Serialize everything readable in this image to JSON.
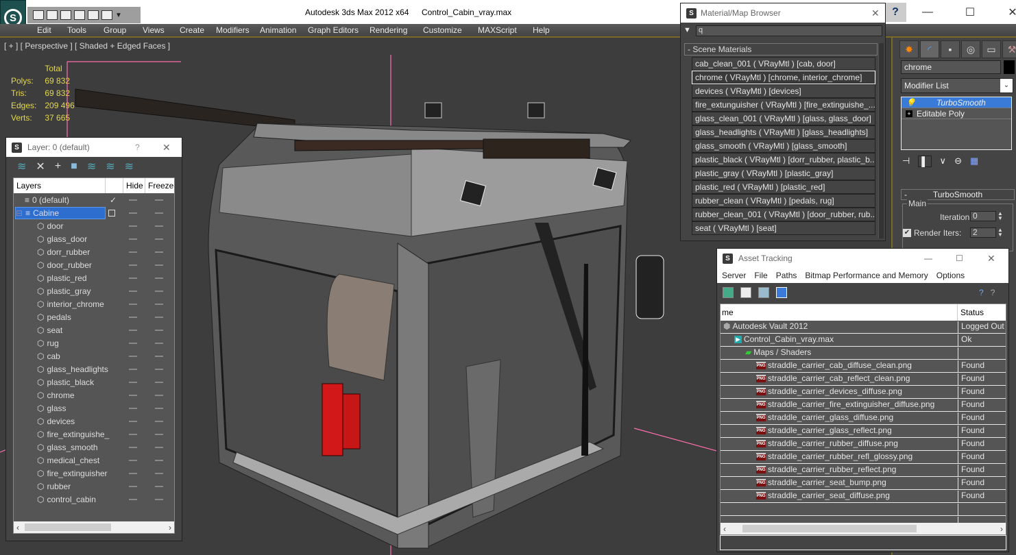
{
  "app": {
    "title": "Autodesk 3ds Max  2012 x64",
    "file": "Control_Cabin_vray.max"
  },
  "menu": [
    "Edit",
    "Tools",
    "Group",
    "Views",
    "Create",
    "Modifiers",
    "Animation",
    "Graph Editors",
    "Rendering",
    "Customize",
    "MAXScript",
    "Help"
  ],
  "viewport": {
    "label": "[ + ] [ Perspective ] [ Shaded + Edged Faces ]",
    "stats": {
      "header": "Total",
      "rows": [
        {
          "label": "Polys:",
          "value": "69 832"
        },
        {
          "label": "Tris:",
          "value": "69 832"
        },
        {
          "label": "Edges:",
          "value": "209 496"
        },
        {
          "label": "Verts:",
          "value": "37 665"
        }
      ]
    }
  },
  "layer_dialog": {
    "title": "Layer: 0 (default)",
    "help": "?",
    "close": "✕",
    "columns": [
      "Layers",
      "",
      "Hide",
      "Freeze"
    ],
    "layers": [
      {
        "name": "0 (default)",
        "type": "layer",
        "current": true
      },
      {
        "name": "Cabine",
        "type": "layer",
        "selected": true
      },
      {
        "name": "door",
        "type": "object"
      },
      {
        "name": "glass_door",
        "type": "object"
      },
      {
        "name": "dorr_rubber",
        "type": "object"
      },
      {
        "name": "door_rubber",
        "type": "object"
      },
      {
        "name": "plastic_red",
        "type": "object"
      },
      {
        "name": "plastic_gray",
        "type": "object"
      },
      {
        "name": "interior_chrome",
        "type": "object"
      },
      {
        "name": "pedals",
        "type": "object"
      },
      {
        "name": "seat",
        "type": "object"
      },
      {
        "name": "rug",
        "type": "object"
      },
      {
        "name": "cab",
        "type": "object"
      },
      {
        "name": "glass_headlights",
        "type": "object"
      },
      {
        "name": "plastic_black",
        "type": "object"
      },
      {
        "name": "chrome",
        "type": "object"
      },
      {
        "name": "glass",
        "type": "object"
      },
      {
        "name": "devices",
        "type": "object"
      },
      {
        "name": "fire_extinguishe_",
        "type": "object"
      },
      {
        "name": "glass_smooth",
        "type": "object"
      },
      {
        "name": "medical_chest",
        "type": "object"
      },
      {
        "name": "fire_extinguisher",
        "type": "object"
      },
      {
        "name": "rubber",
        "type": "object"
      },
      {
        "name": "control_cabin",
        "type": "object"
      }
    ]
  },
  "material_browser": {
    "title": "Material/Map Browser",
    "search_value": "q",
    "section": "- Scene Materials",
    "materials": [
      "cab_clean_001  ( VRayMtl ) [cab, door]",
      "chrome  ( VRayMtl ) [chrome, interior_chrome]",
      "devices  ( VRayMtl ) [devices]",
      "fire_extunguisher  ( VRayMtl ) [fire_extinguishe_...",
      "glass_clean_001  ( VRayMtl ) [glass, glass_door]",
      "glass_headlights  ( VRayMtl ) [glass_headlights]",
      "glass_smooth  ( VRayMtl ) [glass_smooth]",
      "plastic_black  ( VRayMtl ) [dorr_rubber, plastic_b...",
      "plastic_gray  ( VRayMtl ) [plastic_gray]",
      "plastic_red  ( VRayMtl ) [plastic_red]",
      "rubber_clean  ( VRayMtl ) [pedals, rug]",
      "rubber_clean_001  ( VRayMtl ) [door_rubber, rub...",
      "seat  ( VRayMtl ) [seat]"
    ],
    "selected_index": 1
  },
  "command_panel": {
    "object_name": "chrome",
    "modifier_list": "Modifier List",
    "stack": [
      "TurboSmooth",
      "Editable Poly"
    ],
    "rollout": "TurboSmooth",
    "group": "Main",
    "iterations_label": "Iterations:",
    "iterations": "0",
    "render_iters_label": "Render Iters:",
    "render_iters": "2",
    "render_iters_checked": true
  },
  "asset_tracking": {
    "title": "Asset Tracking",
    "menu": [
      "Server",
      "File",
      "Paths",
      "Bitmap Performance and Memory",
      "Options"
    ],
    "columns": [
      "me",
      "Status"
    ],
    "rows": [
      {
        "name": "Autodesk Vault 2012",
        "status": "Logged Out .",
        "level": 0,
        "icon": "vault"
      },
      {
        "name": "Control_Cabin_vray.max",
        "status": "Ok",
        "level": 1,
        "icon": "max"
      },
      {
        "name": "Maps / Shaders",
        "status": "",
        "level": 2,
        "icon": "maps"
      },
      {
        "name": "straddle_carrier_cab_diffuse_clean.png",
        "status": "Found",
        "level": 3,
        "icon": "png"
      },
      {
        "name": "straddle_carrier_cab_reflect_clean.png",
        "status": "Found",
        "level": 3,
        "icon": "png"
      },
      {
        "name": "straddle_carrier_devices_diffuse.png",
        "status": "Found",
        "level": 3,
        "icon": "png"
      },
      {
        "name": "straddle_carrier_fire_extinguisher_diffuse.png",
        "status": "Found",
        "level": 3,
        "icon": "png"
      },
      {
        "name": "straddle_carrier_glass_diffuse.png",
        "status": "Found",
        "level": 3,
        "icon": "png"
      },
      {
        "name": "straddle_carrier_glass_reflect.png",
        "status": "Found",
        "level": 3,
        "icon": "png"
      },
      {
        "name": "straddle_carrier_rubber_diffuse.png",
        "status": "Found",
        "level": 3,
        "icon": "png"
      },
      {
        "name": "straddle_carrier_rubber_refl_glossy.png",
        "status": "Found",
        "level": 3,
        "icon": "png"
      },
      {
        "name": "straddle_carrier_rubber_reflect.png",
        "status": "Found",
        "level": 3,
        "icon": "png"
      },
      {
        "name": "straddle_carrier_seat_bump.png",
        "status": "Found",
        "level": 3,
        "icon": "png"
      },
      {
        "name": "straddle_carrier_seat_diffuse.png",
        "status": "Found",
        "level": 3,
        "icon": "png"
      }
    ]
  },
  "colors": {
    "accent_selection": "#2d6ecf",
    "stats_yellow": "#e6d94a",
    "viewport_bg": "#3d3d3d",
    "gizmo_pink": "#ff6fb0"
  }
}
